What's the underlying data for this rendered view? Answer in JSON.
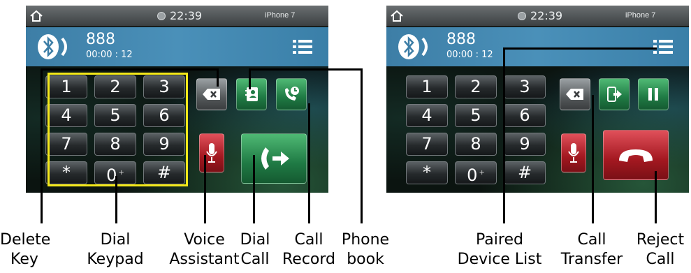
{
  "left_screen": {
    "status": {
      "time": "22:39",
      "device_name": "iPhone 7"
    },
    "call_info": {
      "number": "888",
      "duration": "00:00 : 12"
    },
    "keypad": {
      "keys": [
        {
          "label": "1"
        },
        {
          "label": "2"
        },
        {
          "label": "3"
        },
        {
          "label": "4"
        },
        {
          "label": "5"
        },
        {
          "label": "6"
        },
        {
          "label": "7"
        },
        {
          "label": "8"
        },
        {
          "label": "9"
        },
        {
          "label": "*"
        },
        {
          "label": "0",
          "sub": "+"
        },
        {
          "label": "#"
        }
      ]
    },
    "buttons": {
      "delete": "backspace-icon",
      "phonebook": "contacts-book-icon",
      "call_record": "call-history-icon",
      "voice": "microphone-icon",
      "dial": "call-arrow-icon"
    }
  },
  "right_screen": {
    "status": {
      "time": "22:39",
      "device_name": "iPhone 7"
    },
    "call_info": {
      "number": "888",
      "duration": "00:00 : 12"
    },
    "keypad": {
      "keys": [
        {
          "label": "1"
        },
        {
          "label": "2"
        },
        {
          "label": "3"
        },
        {
          "label": "4"
        },
        {
          "label": "5"
        },
        {
          "label": "6"
        },
        {
          "label": "7"
        },
        {
          "label": "8"
        },
        {
          "label": "9"
        },
        {
          "label": "*"
        },
        {
          "label": "0",
          "sub": "+"
        },
        {
          "label": "#"
        }
      ]
    },
    "buttons": {
      "delete": "backspace-icon",
      "transfer": "call-transfer-icon",
      "pause": "pause-icon",
      "voice": "microphone-icon",
      "reject": "hang-up-icon"
    }
  },
  "annotations": {
    "delete_key": [
      "Delete",
      "Key"
    ],
    "dial_keypad": [
      "Dial",
      "Keypad"
    ],
    "voice_assistant": [
      "Voice",
      "Assistant"
    ],
    "dial_call": [
      "Dial",
      "Call"
    ],
    "call_record": [
      "Call",
      "Record"
    ],
    "phone_book": [
      "Phone",
      "book"
    ],
    "paired_device_list": [
      "Paired",
      "Device List"
    ],
    "call_transfer": [
      "Call",
      "Transfer"
    ],
    "reject_call": [
      "Reject",
      "Call"
    ]
  },
  "colors": {
    "highlight": "#f3e81a",
    "info_bar": "#4a90b9",
    "green_button": "#1f7a44",
    "red_button": "#a31820"
  }
}
